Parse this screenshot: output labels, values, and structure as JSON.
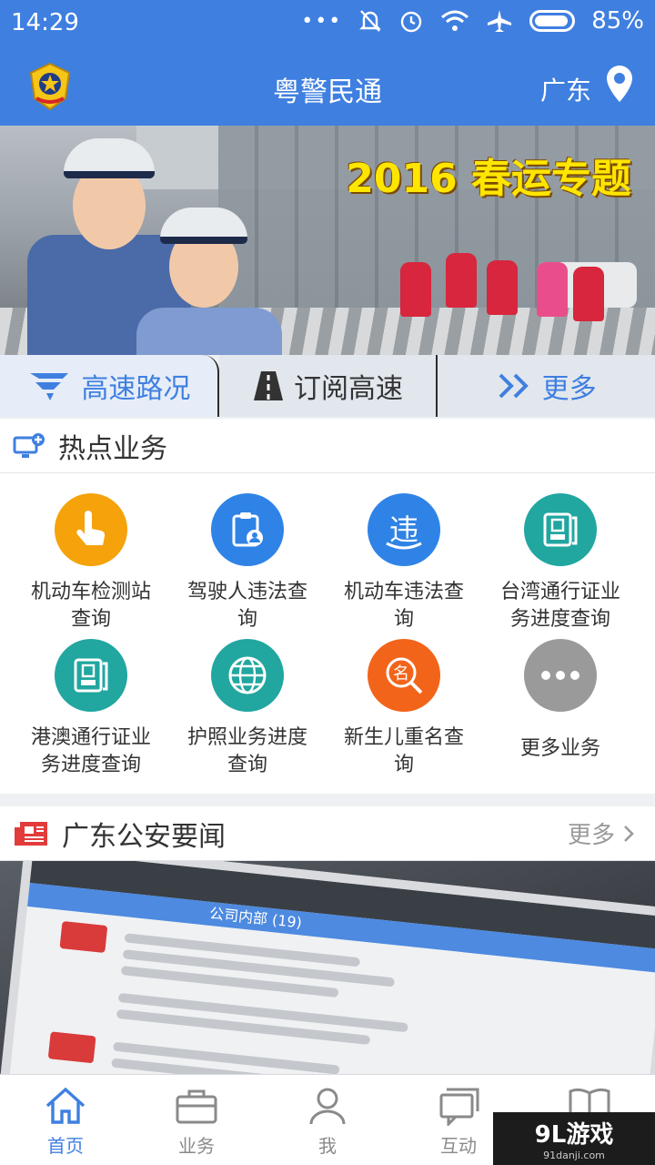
{
  "status": {
    "time": "14:29",
    "battery": "85%"
  },
  "header": {
    "title": "粤警民通",
    "location": "广东"
  },
  "banner": {
    "headline": "2016 春运专题"
  },
  "quick_tabs": [
    {
      "label": "高速路况"
    },
    {
      "label": "订阅高速"
    },
    {
      "label": "更多"
    }
  ],
  "hot": {
    "title": "热点业务",
    "items": [
      {
        "label_l1": "机动车检测站",
        "label_l2": "查询",
        "color": "#f5a20b",
        "icon": "hand-tap-icon"
      },
      {
        "label_l1": "驾驶人违法查",
        "label_l2": "询",
        "color": "#2f83e6",
        "icon": "driver-icon"
      },
      {
        "label_l1": "机动车违法查",
        "label_l2": "询",
        "color": "#2f83e6",
        "icon": "violation-icon"
      },
      {
        "label_l1": "台湾通行证业",
        "label_l2": "务进度查询",
        "color": "#21a6a0",
        "icon": "taiwan-pass-icon"
      },
      {
        "label_l1": "港澳通行证业",
        "label_l2": "务进度查询",
        "color": "#21a6a0",
        "icon": "hk-macau-pass-icon"
      },
      {
        "label_l1": "护照业务进度",
        "label_l2": "查询",
        "color": "#21a6a0",
        "icon": "globe-icon"
      },
      {
        "label_l1": "新生儿重名查",
        "label_l2": "询",
        "color": "#f2641a",
        "icon": "name-search-icon"
      },
      {
        "label_l1": "更多业务",
        "label_l2": "",
        "color": "#9a9a9a",
        "icon": "more-dots-icon"
      }
    ]
  },
  "news": {
    "title": "广东公安要闻",
    "more": "更多",
    "phone_texts": [
      "公司内部",
      "(19)"
    ]
  },
  "bottom_nav": [
    {
      "label": "首页",
      "icon": "home-icon"
    },
    {
      "label": "业务",
      "icon": "briefcase-icon"
    },
    {
      "label": "我",
      "icon": "user-icon"
    },
    {
      "label": "互动",
      "icon": "chat-icon"
    },
    {
      "label": "",
      "icon": "book-icon"
    }
  ],
  "watermark": {
    "main": "9L游戏",
    "sub": "91danji.com"
  }
}
